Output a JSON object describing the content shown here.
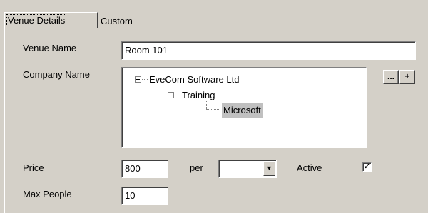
{
  "tabs": [
    {
      "label": "Venue Details",
      "active": true
    },
    {
      "label": "Custom",
      "active": false
    }
  ],
  "form": {
    "venue_name_label": "Venue Name",
    "venue_name_value": "Room 101",
    "company_name_label": "Company Name",
    "company_tree": {
      "root": "EveCom Software Ltd",
      "child": "Training",
      "grandchild": "Microsoft"
    },
    "browse_button_label": "...",
    "add_button_label": "+",
    "price_label": "Price",
    "price_value": "800",
    "per_label": "per",
    "per_value": "",
    "active_label": "Active",
    "active_checked": true,
    "active_check_glyph": "✓",
    "max_people_label": "Max People",
    "max_people_value": "10"
  },
  "icons": {
    "dropdown_arrow": "▼"
  }
}
